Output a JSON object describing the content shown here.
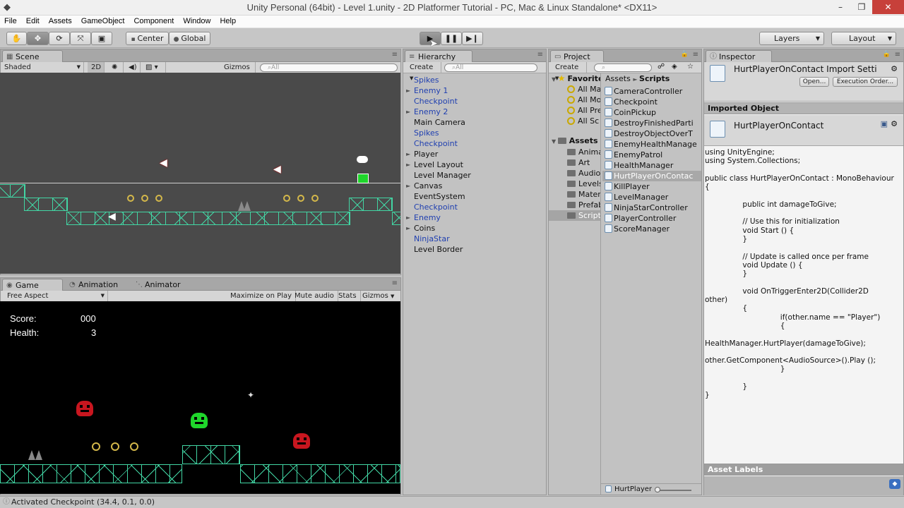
{
  "window": {
    "title": "Unity Personal (64bit) - Level 1.unity - 2D Platformer Tutorial - PC, Mac & Linux Standalone* <DX11>"
  },
  "menu": [
    "File",
    "Edit",
    "Assets",
    "GameObject",
    "Component",
    "Window",
    "Help"
  ],
  "toolbar": {
    "pivot": "Center",
    "space": "Global",
    "layers": "Layers",
    "layout": "Layout"
  },
  "scene": {
    "tab": "Scene",
    "shading": "Shaded",
    "mode_2d": "2D",
    "gizmos": "Gizmos",
    "search_placeholder": "All"
  },
  "game": {
    "tabs": [
      "Game",
      "Animation",
      "Animator"
    ],
    "aspect": "Free Aspect",
    "buttons": [
      "Maximize on Play",
      "Mute audio",
      "Stats",
      "Gizmos"
    ],
    "score_label": "Score:",
    "score_value": "000",
    "health_label": "Health:",
    "health_value": "3"
  },
  "hierarchy": {
    "tab": "Hierarchy",
    "create": "Create",
    "search_placeholder": "All",
    "items": [
      {
        "label": "Spikes",
        "prefab": true,
        "expandable": false
      },
      {
        "label": "Enemy 1",
        "prefab": true,
        "expandable": true
      },
      {
        "label": "Checkpoint",
        "prefab": true,
        "expandable": false
      },
      {
        "label": "Enemy 2",
        "prefab": true,
        "expandable": true
      },
      {
        "label": "Main Camera",
        "prefab": false,
        "expandable": false
      },
      {
        "label": "Spikes",
        "prefab": true,
        "expandable": false
      },
      {
        "label": "Checkpoint",
        "prefab": true,
        "expandable": false
      },
      {
        "label": "Player",
        "prefab": false,
        "expandable": true
      },
      {
        "label": "Level Layout",
        "prefab": false,
        "expandable": true
      },
      {
        "label": "Level Manager",
        "prefab": false,
        "expandable": false
      },
      {
        "label": "Canvas",
        "prefab": false,
        "expandable": true
      },
      {
        "label": "EventSystem",
        "prefab": false,
        "expandable": false
      },
      {
        "label": "Checkpoint",
        "prefab": true,
        "expandable": false
      },
      {
        "label": "Enemy",
        "prefab": true,
        "expandable": true
      },
      {
        "label": "Coins",
        "prefab": false,
        "expandable": true
      },
      {
        "label": "NinjaStar",
        "prefab": true,
        "expandable": false
      },
      {
        "label": "Level Border",
        "prefab": false,
        "expandable": false
      }
    ]
  },
  "project": {
    "tab": "Project",
    "create": "Create",
    "favorites_label": "Favorites",
    "favorites": [
      "All Ma",
      "All Mo",
      "All Pre",
      "All Sc"
    ],
    "assets_label": "Assets",
    "folders": [
      "Anima",
      "Art",
      "Audio",
      "Levels",
      "Mater",
      "Prefab",
      "Scripts"
    ],
    "breadcrumb": [
      "Assets",
      "Scripts"
    ],
    "scripts": [
      "CameraController",
      "Checkpoint",
      "CoinPickup",
      "DestroyFinishedParti",
      "DestroyObjectOverT",
      "EnemyHealthManage",
      "EnemyPatrol",
      "HealthManager",
      "HurtPlayerOnContac",
      "KillPlayer",
      "LevelManager",
      "NinjaStarController",
      "PlayerController",
      "ScoreManager"
    ],
    "selected_script": "HurtPlayerOnContac",
    "footer": "HurtPlayer"
  },
  "inspector": {
    "tab": "Inspector",
    "title": "HurtPlayerOnContact Import Setti",
    "open_btn": "Open...",
    "exec_btn": "Execution Order...",
    "imported_object": "Imported Object",
    "object_name": "HurtPlayerOnContact",
    "code": "using UnityEngine;\nusing System.Collections;\n\npublic class HurtPlayerOnContact : MonoBehaviour\n{\n\n                public int damageToGive;\n\n                // Use this for initialization\n                void Start () {\n                }\n\n                // Update is called once per frame\n                void Update () {\n                }\n\n                void OnTriggerEnter2D(Collider2D\nother)\n                {\n                                if(other.name == \"Player\")\n                                {\n\nHealthManager.HurtPlayer(damageToGive);\n\nother.GetComponent<AudioSource>().Play ();\n                                }\n\n                }\n}",
    "asset_labels": "Asset Labels"
  },
  "status": {
    "text": "Activated Checkpoint (34.4, 0.1, 0.0)"
  },
  "colors": {
    "tile": "#42d6a4",
    "enemy": "#c8161f",
    "player": "#1fd62b",
    "coin": "#d4b84a"
  }
}
